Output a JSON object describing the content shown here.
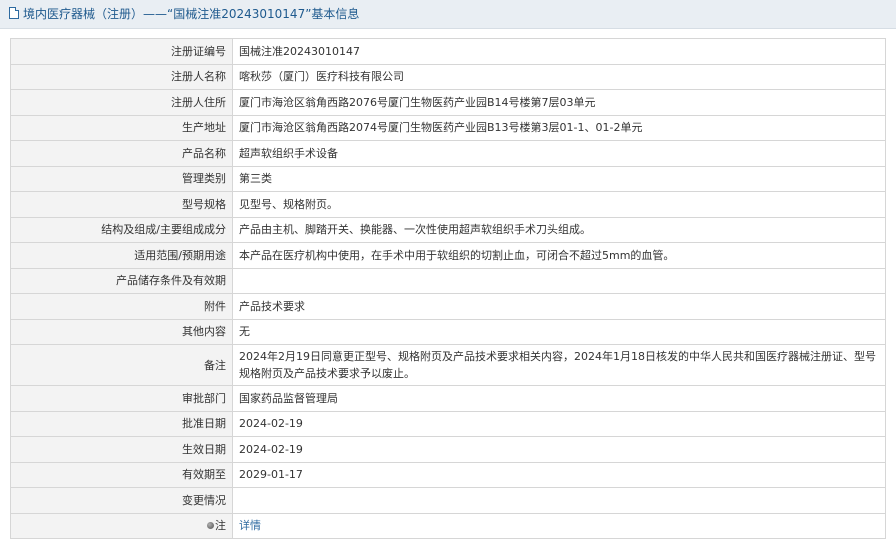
{
  "header": {
    "title": "境内医疗器械（注册）——“国械注准20243010147”基本信息"
  },
  "rows": [
    {
      "label": "注册证编号",
      "value": "国械注准20243010147"
    },
    {
      "label": "注册人名称",
      "value": "喀秋莎（厦门）医疗科技有限公司"
    },
    {
      "label": "注册人住所",
      "value": "厦门市海沧区翁角西路2076号厦门生物医药产业园B14号楼第7层03单元"
    },
    {
      "label": "生产地址",
      "value": "厦门市海沧区翁角西路2074号厦门生物医药产业园B13号楼第3层01-1、01-2单元"
    },
    {
      "label": "产品名称",
      "value": "超声软组织手术设备"
    },
    {
      "label": "管理类别",
      "value": "第三类"
    },
    {
      "label": "型号规格",
      "value": "见型号、规格附页。"
    },
    {
      "label": "结构及组成/主要组成成分",
      "value": "产品由主机、脚踏开关、换能器、一次性使用超声软组织手术刀头组成。"
    },
    {
      "label": "适用范围/预期用途",
      "value": "本产品在医疗机构中使用，在手术中用于软组织的切割止血，可闭合不超过5mm的血管。"
    },
    {
      "label": "产品储存条件及有效期",
      "value": ""
    },
    {
      "label": "附件",
      "value": "产品技术要求"
    },
    {
      "label": "其他内容",
      "value": "无"
    },
    {
      "label": "备注",
      "value": "2024年2月19日同意更正型号、规格附页及产品技术要求相关内容，2024年1月18日核发的中华人民共和国医疗器械注册证、型号规格附页及产品技术要求予以废止。"
    },
    {
      "label": "审批部门",
      "value": "国家药品监督管理局"
    },
    {
      "label": "批准日期",
      "value": "2024-02-19"
    },
    {
      "label": "生效日期",
      "value": "2024-02-19"
    },
    {
      "label": "有效期至",
      "value": "2029-01-17"
    },
    {
      "label": "变更情况",
      "value": ""
    }
  ],
  "note": {
    "label": "注",
    "link_text": "详情",
    "icon": "bullet-dot-icon"
  },
  "colors": {
    "header_bg": "#e9eef3",
    "header_text": "#1f5a8e",
    "label_bg": "#f3f3f3",
    "border": "#d6d6d6",
    "link": "#2d6aa0"
  }
}
